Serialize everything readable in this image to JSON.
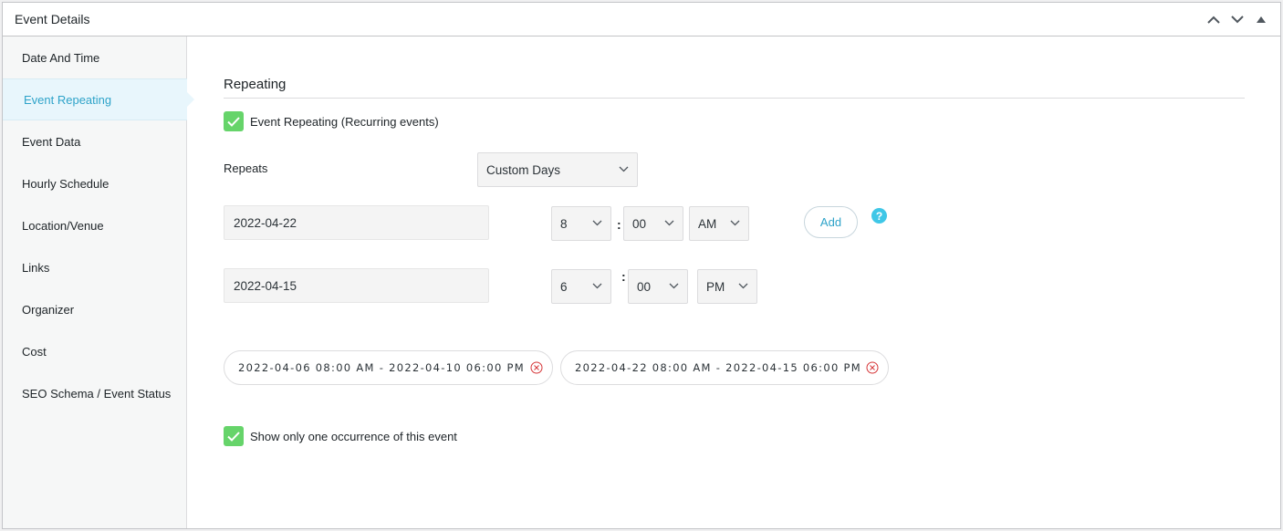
{
  "panel": {
    "title": "Event Details"
  },
  "sidebar": {
    "items": [
      {
        "label": "Date And Time"
      },
      {
        "label": "Event Repeating"
      },
      {
        "label": "Event Data"
      },
      {
        "label": "Hourly Schedule"
      },
      {
        "label": "Location/Venue"
      },
      {
        "label": "Links"
      },
      {
        "label": "Organizer"
      },
      {
        "label": "Cost"
      },
      {
        "label": "SEO Schema / Event Status"
      }
    ],
    "active": "Event Repeating"
  },
  "main": {
    "section_title": "Repeating",
    "repeating_checkbox": {
      "label": "Event Repeating (Recurring events)",
      "checked": true
    },
    "repeats_label": "Repeats",
    "repeats_select": {
      "value": "Custom Days"
    },
    "start": {
      "date": "2022-04-22",
      "hour": "8",
      "minute": "00",
      "ampm": "AM"
    },
    "end": {
      "date": "2022-04-15",
      "hour": "6",
      "minute": "00",
      "ampm": "PM"
    },
    "colon": ":",
    "add_label": "Add",
    "help_icon": "?",
    "occurrences": [
      {
        "text": "2022-04-06 08:00 AM - 2022-04-10 06:00 PM"
      },
      {
        "text": "2022-04-22 08:00 AM - 2022-04-15 06:00 PM"
      }
    ],
    "one_occurrence_checkbox": {
      "label": "Show only one occurrence of this event",
      "checked": true
    }
  },
  "icons": {
    "collapse_up": "chevron-up-icon",
    "collapse_down": "chevron-down-icon",
    "toggle": "triangle-up-icon",
    "checkmark": "checkmark-icon",
    "remove": "circle-x-icon"
  },
  "colors": {
    "accent": "#2ea3c9",
    "checkbox": "#66d46a",
    "help": "#3fc7e7",
    "remove": "#d63638",
    "active_bg": "#e8f6fc"
  }
}
